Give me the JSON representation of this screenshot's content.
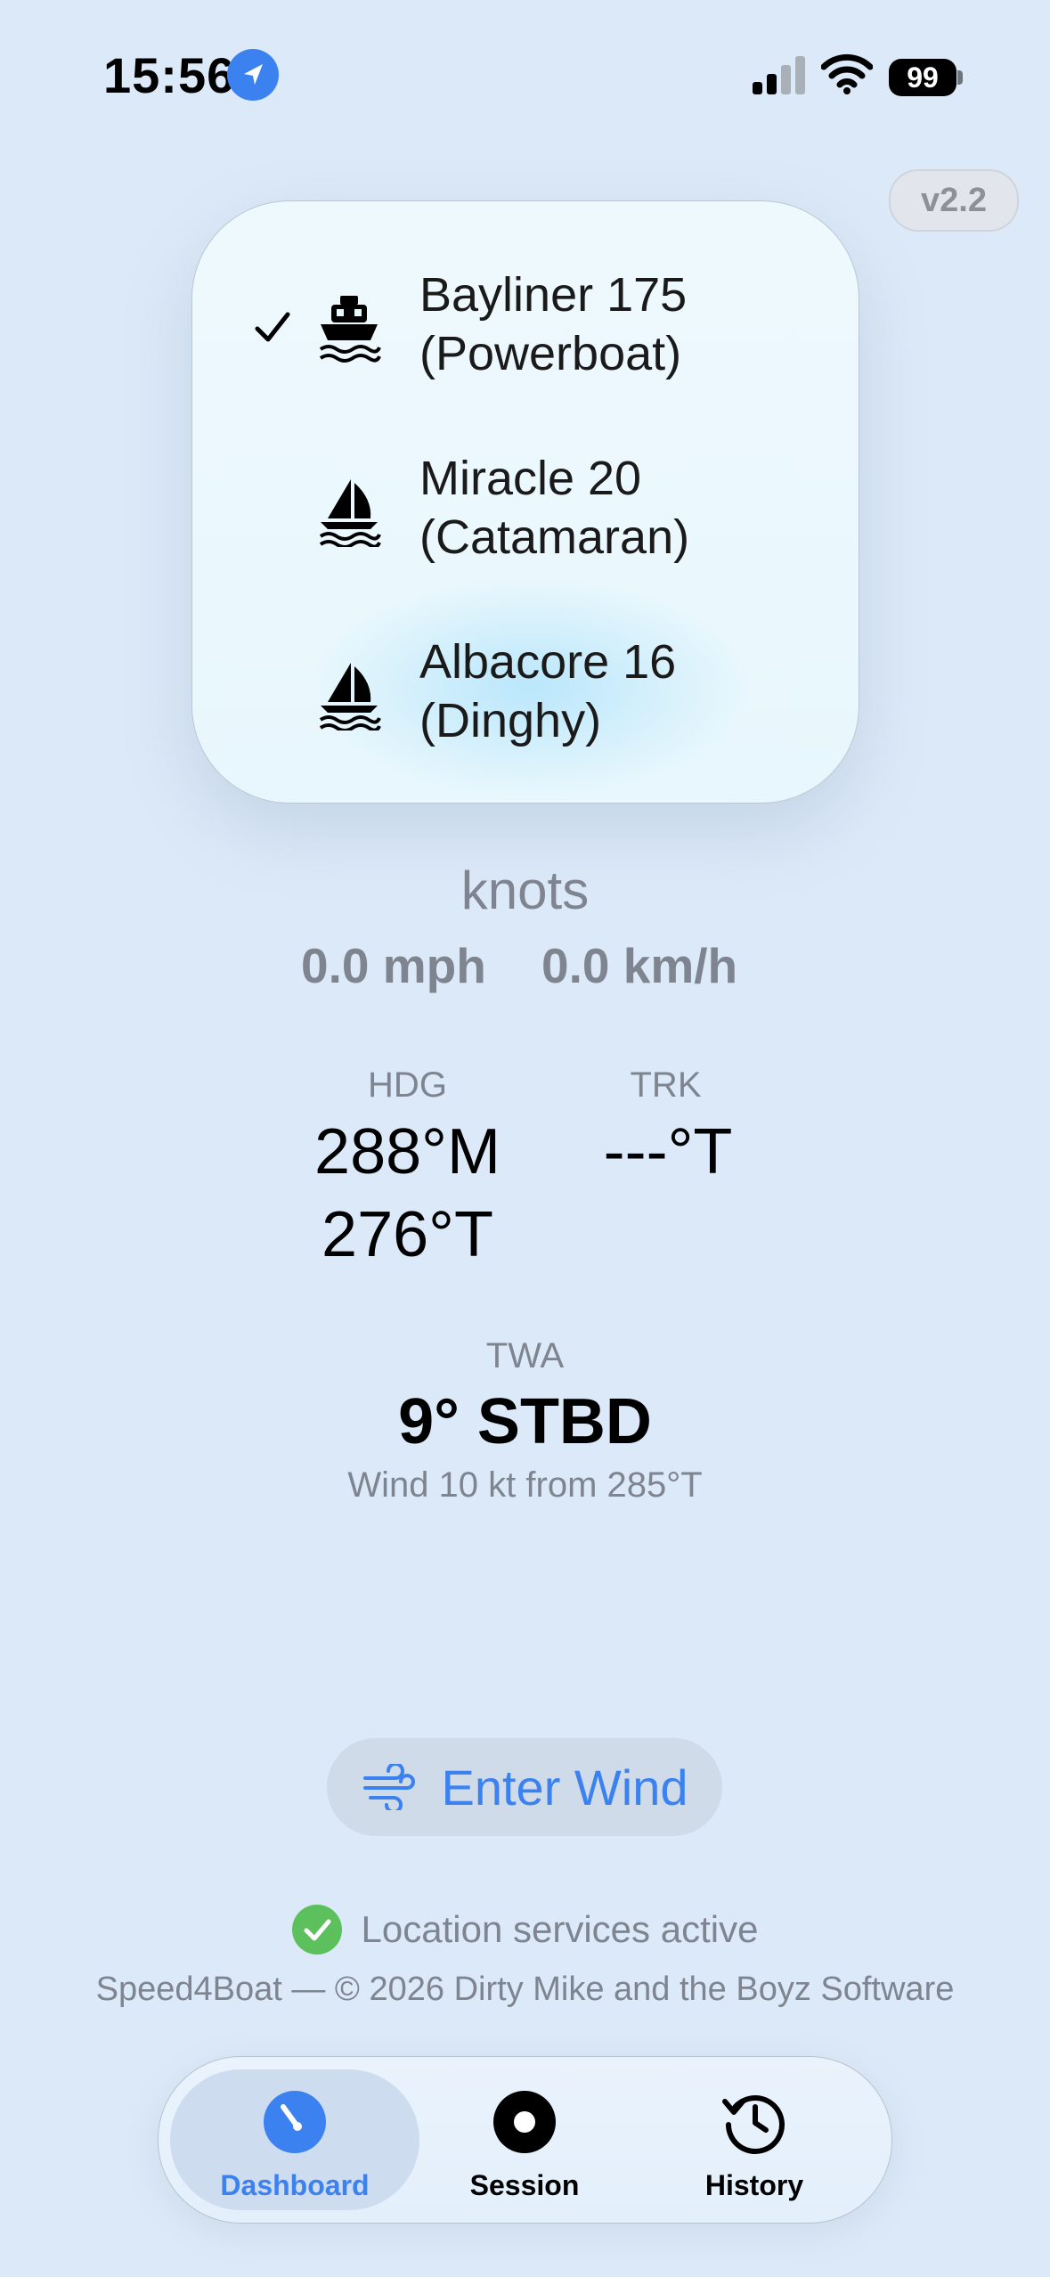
{
  "status_bar": {
    "time": "15:56",
    "battery": "99"
  },
  "version": "v2.2",
  "boat_menu": {
    "items": [
      {
        "name": "Bayliner 175",
        "type": "(Powerboat)",
        "icon": "powerboat-icon",
        "selected": true
      },
      {
        "name": "Miracle 20",
        "type": "(Catamaran)",
        "icon": "sailboat-icon",
        "selected": false
      },
      {
        "name": "Albacore 16",
        "type": "(Dinghy)",
        "icon": "sailboat-icon",
        "selected": false
      }
    ]
  },
  "speed": {
    "unit": "knots",
    "mph": "0.0 mph",
    "kmh": "0.0 km/h"
  },
  "heading": {
    "label": "HDG",
    "magnetic": "288°M",
    "true": "276°T"
  },
  "track": {
    "label": "TRK",
    "true": "---°T"
  },
  "twa": {
    "label": "TWA",
    "value": "9° STBD",
    "wind": "Wind 10 kt from 285°T"
  },
  "enter_wind_button": {
    "label": "Enter Wind"
  },
  "location_status": "Location services active",
  "footer": "Speed4Boat — © 2026 Dirty Mike and the Boyz Software",
  "tabs": [
    {
      "label": "Dashboard",
      "icon": "gauge-icon",
      "active": true
    },
    {
      "label": "Session",
      "icon": "record-icon",
      "active": false
    },
    {
      "label": "History",
      "icon": "history-icon",
      "active": false
    }
  ],
  "colors": {
    "accent": "#3b82f0",
    "background": "#dce9f8",
    "secondary_text": "#7e8590",
    "success": "#5cc05c"
  }
}
